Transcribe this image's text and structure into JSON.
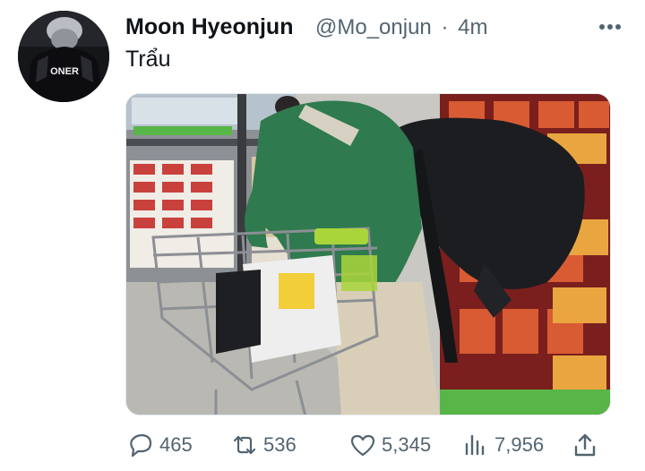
{
  "tweet": {
    "author": {
      "display_name": "Moon Hyeonjun",
      "handle": "@Mo_onjun",
      "separator": "·",
      "time": "4m",
      "avatar_jersey_text": "ONER"
    },
    "text": "Trẩu",
    "media": {
      "type": "photo",
      "icon": "photo"
    },
    "actions": {
      "replies": "465",
      "retweets": "536",
      "likes": "5,345",
      "views": "7,956"
    },
    "icons": [
      "more-icon",
      "reply-icon",
      "retweet-icon",
      "like-icon",
      "views-icon",
      "share-icon"
    ],
    "colors": {
      "text": "#0f1419",
      "secondary": "#536471",
      "jacket": "#2f7a4e"
    }
  }
}
